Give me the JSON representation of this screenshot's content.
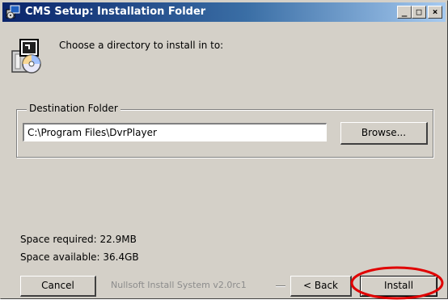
{
  "window": {
    "title": "CMS Setup: Installation Folder",
    "controls": {
      "minimize": "_",
      "maximize": "□",
      "close": "×"
    }
  },
  "header": {
    "instruction": "Choose a directory to install in to:",
    "icon": "installer-disk-icon"
  },
  "destination": {
    "group_label": "Destination Folder",
    "path": "C:\\Program Files\\DvrPlayer",
    "browse_label": "Browse..."
  },
  "space": {
    "required": "Space required: 22.9MB",
    "available": "Space available: 36.4GB"
  },
  "footer": {
    "cancel_label": "Cancel",
    "branding": "Nullsoft Install System v2.0rc1",
    "back_label": "< Back",
    "install_label": "Install"
  },
  "colors": {
    "title_gradient_start": "#0a246a",
    "title_gradient_end": "#a6caf0",
    "dialog_face": "#d4d0c8",
    "annotation_circle": "#e00000"
  }
}
